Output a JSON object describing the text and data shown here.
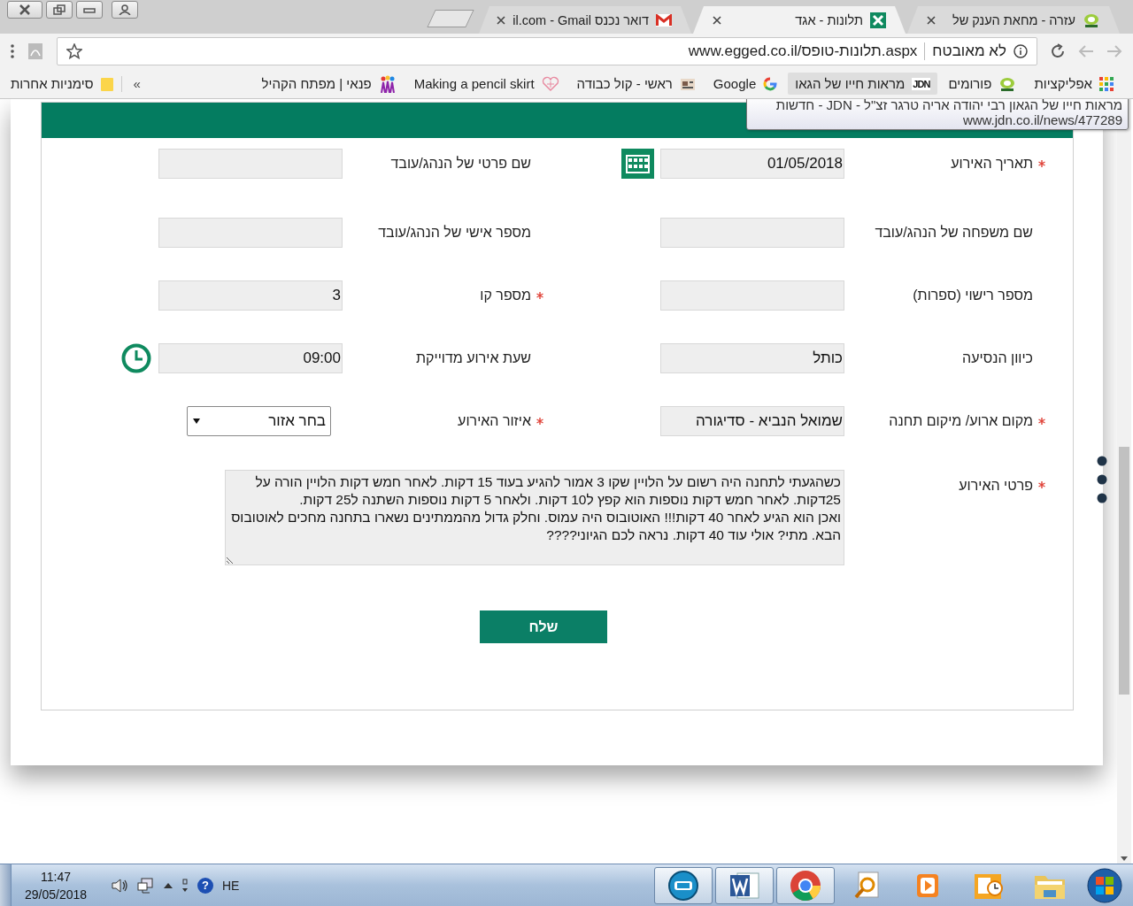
{
  "tabs": [
    {
      "kind": "forum",
      "title": "עזרה - מחאת הענק של",
      "selected": false
    },
    {
      "kind": "sheet",
      "title": "תלונות - אגד",
      "selected": true
    },
    {
      "kind": "mail",
      "title": "il.com - Gmail דואר נכנס",
      "selected": false
    }
  ],
  "toolbar": {
    "security": "לא מאובטח",
    "url": "www.egged.co.il/תלונות-טופס.aspx"
  },
  "bookmarks": [
    {
      "kind": "apps",
      "label": "אפליקציות",
      "hovered": false
    },
    {
      "kind": "forum",
      "label": "פורומים",
      "hovered": false
    },
    {
      "kind": "jdn",
      "logo": "JDN",
      "label": "מראות חייו של הגאו",
      "hovered": true
    },
    {
      "kind": "google",
      "label": "Google",
      "hovered": false
    },
    {
      "kind": "news",
      "label": "ראשי - קול כבודה",
      "hovered": false
    },
    {
      "kind": "heart",
      "label": "Making a pencil skirt",
      "hovered": false
    },
    {
      "kind": "people",
      "label": "פנאי | מפתח הקהיל",
      "hovered": false
    }
  ],
  "bookmarks_overflow": "»",
  "other_bookmarks": "סימניות אחרות",
  "tooltip": {
    "title": "מראות חייו של הגאון רבי יהודה אריה טרגר זצ\"ל - JDN - חדשות",
    "url": "www.jdn.co.il/news/477289"
  },
  "form": {
    "fields": [
      {
        "kind": "date",
        "label": "תאריך האירוע",
        "required": true,
        "value": "01/05/2018"
      },
      {
        "kind": "text",
        "label": "שם פרטי של הנהג/עובד",
        "required": false
      },
      {
        "kind": "text",
        "label": "שם משפחה של הנהג/עובד",
        "required": false
      },
      {
        "kind": "text",
        "label": "מספר אישי של הנהג/עובד",
        "required": false
      },
      {
        "kind": "text",
        "label": "מספר רישוי (ספרות)",
        "required": false
      },
      {
        "kind": "text",
        "label": "מספר קו",
        "required": true,
        "value": "3"
      },
      {
        "kind": "text",
        "label": "כיוון הנסיעה",
        "required": false,
        "value": "כותל"
      },
      {
        "kind": "time",
        "label": "שעת אירוע מדוייקת",
        "required": false,
        "value": "09:00"
      },
      {
        "kind": "text",
        "label": "מקום ארוע/ מיקום תחנה",
        "required": true,
        "value": "שמואל הנביא - סדיגורה"
      },
      {
        "kind": "select",
        "label": "איזור האירוע",
        "required": true,
        "value": "בחר אזור"
      },
      {
        "kind": "textarea",
        "label": "פרטי האירוע",
        "required": true,
        "value": "כשהגעתי לתחנה היה רשום על הלויין שקו 3 אמור להגיע בעוד 15 דקות. לאחר חמש דקות הלויין הורה על 25דקות. לאחר חמש דקות נוספות הוא קפץ ל10 דקות. ולאחר 5 דקות נוספות השתנה ל25 דקות.\nואכן הוא הגיע לאחר 40 דקות!!! האוטובוס היה עמוס. וחלק גדול מהממתינים נשארו בתחנה מחכים לאוטובוס הבא. מתי? אולי עוד 40 דקות. נראה לכם הגיוני????"
      }
    ],
    "submit": "שלח"
  },
  "taskbar": {
    "time": "11:47",
    "date": "29/05/2018",
    "help": "?",
    "language": "HE",
    "apps": [
      {
        "kind": "start",
        "active": false
      },
      {
        "kind": "folder",
        "active": false
      },
      {
        "kind": "outlook",
        "active": false
      },
      {
        "kind": "media",
        "active": false
      },
      {
        "kind": "search",
        "active": false
      },
      {
        "kind": "chrome",
        "active": true
      },
      {
        "kind": "word",
        "active": true
      },
      {
        "kind": "dbs",
        "active": true
      }
    ]
  }
}
